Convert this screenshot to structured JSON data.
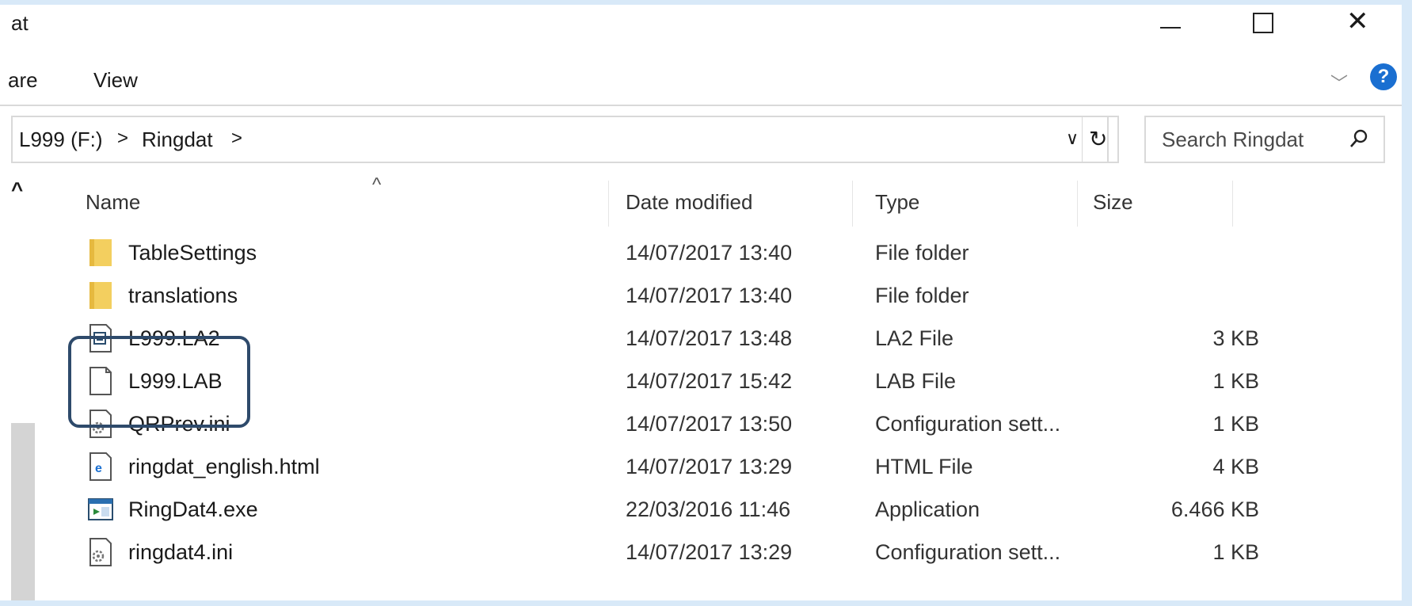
{
  "window": {
    "title": "at",
    "minimize_icon": "minimize-icon",
    "maximize_icon": "maximize-icon",
    "close_icon": "close-icon"
  },
  "ribbon": {
    "tabs": [
      "are",
      "View"
    ],
    "expand_icon": "chevron-down-icon",
    "help_icon": "help-icon",
    "help_label": "?"
  },
  "address": {
    "crumbs": [
      "L999 (F:)",
      "Ringdat"
    ],
    "separator": ">",
    "dropdown_icon": "chevron-down-icon",
    "refresh_icon": "refresh-icon"
  },
  "search": {
    "placeholder": "Search Ringdat",
    "icon": "search-icon"
  },
  "nav": {
    "up_arrow": "^"
  },
  "columns": {
    "name": "Name",
    "date": "Date modified",
    "type": "Type",
    "size": "Size",
    "sort_indicator": "^"
  },
  "files": [
    {
      "name": "TableSettings",
      "date": "14/07/2017 13:40",
      "type": "File folder",
      "size": "",
      "icon": "folder-icon"
    },
    {
      "name": "translations",
      "date": "14/07/2017 13:40",
      "type": "File folder",
      "size": "",
      "icon": "folder-icon"
    },
    {
      "name": "L999.LA2",
      "date": "14/07/2017 13:48",
      "type": "LA2 File",
      "size": "3 KB",
      "icon": "la2-file-icon"
    },
    {
      "name": "L999.LAB",
      "date": "14/07/2017 15:42",
      "type": "LAB File",
      "size": "1 KB",
      "icon": "blank-file-icon"
    },
    {
      "name": "QRPrev.ini",
      "date": "14/07/2017 13:50",
      "type": "Configuration sett...",
      "size": "1 KB",
      "icon": "config-file-icon"
    },
    {
      "name": "ringdat_english.html",
      "date": "14/07/2017 13:29",
      "type": "HTML File",
      "size": "4 KB",
      "icon": "html-file-icon"
    },
    {
      "name": "RingDat4.exe",
      "date": "22/03/2016 11:46",
      "type": "Application",
      "size": "6.466 KB",
      "icon": "application-icon"
    },
    {
      "name": "ringdat4.ini",
      "date": "14/07/2017 13:29",
      "type": "Configuration sett...",
      "size": "1 KB",
      "icon": "config-file-icon"
    }
  ],
  "colors": {
    "accent_highlight": "#2e4a6b",
    "folder": "#f3cf5f",
    "background": "#d8e9f8"
  }
}
